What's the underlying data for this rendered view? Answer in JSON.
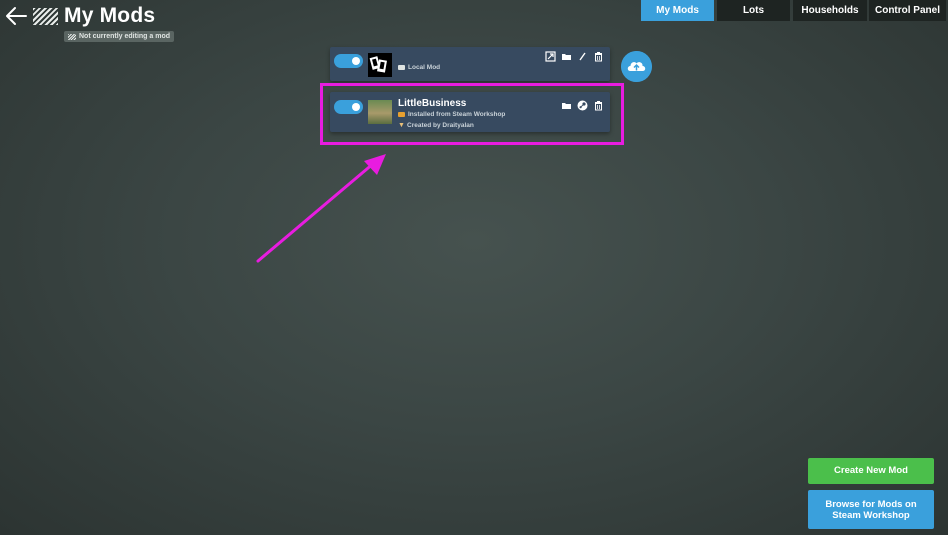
{
  "header": {
    "title": "My Mods",
    "editing_status": "Not currently editing a mod"
  },
  "tabs": [
    {
      "label": "My Mods",
      "active": true
    },
    {
      "label": "Lots",
      "active": false
    },
    {
      "label": "Households",
      "active": false
    },
    {
      "label": "Control Panel",
      "active": false
    }
  ],
  "mods": [
    {
      "name": "",
      "source": "Local Mod",
      "author": "",
      "enabled": true,
      "actions": [
        "export-icon",
        "folder-icon",
        "edit-icon",
        "trash-icon"
      ]
    },
    {
      "name": "LittleBusiness",
      "source": "Installed from Steam Workshop",
      "author": "Created by Draityalan",
      "enabled": true,
      "actions": [
        "folder-icon",
        "steam-icon",
        "trash-icon"
      ]
    }
  ],
  "buttons": {
    "create": "Create New Mod",
    "browse": "Browse for Mods on Steam Workshop"
  },
  "colors": {
    "accent_blue": "#3aa0dc",
    "create_green": "#4bbf4b",
    "highlight_magenta": "#e81ce0",
    "row_bg": "#374a60"
  }
}
